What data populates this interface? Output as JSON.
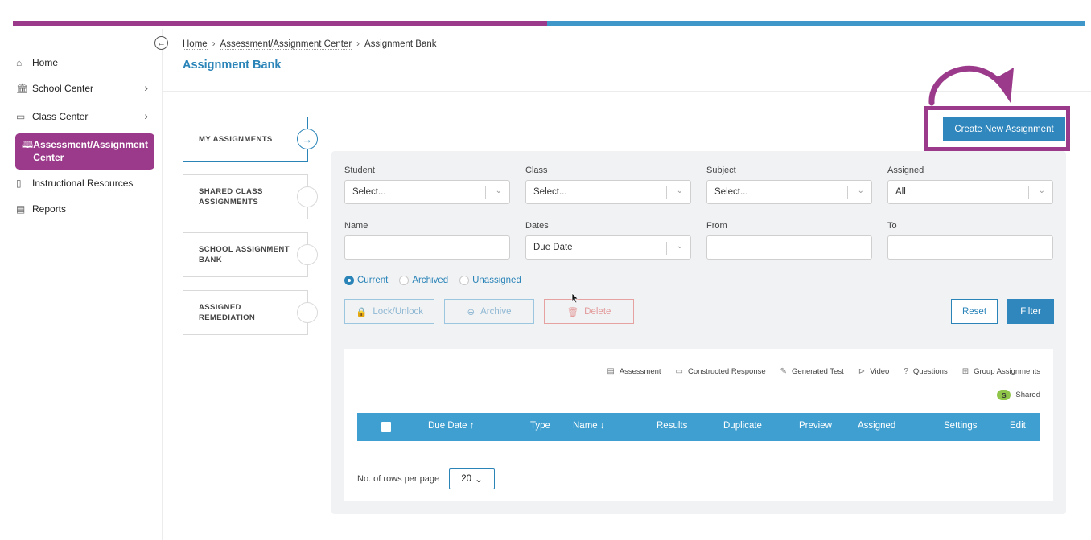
{
  "colors": {
    "brand_purple": "#9b3a8a",
    "brand_blue": "#3f97c9",
    "link_blue": "#2a84b8",
    "button_blue": "#2f87bd",
    "table_header": "#3f9fd0",
    "shared_badge": "#8fc64a"
  },
  "sidebar": {
    "items": [
      {
        "label": "Home",
        "icon": "home-icon"
      },
      {
        "label": "School Center",
        "icon": "school-icon"
      },
      {
        "label": "Class Center",
        "icon": "class-icon"
      },
      {
        "label": "Assessment/Assignment Center",
        "icon": "book-icon"
      },
      {
        "label": "Instructional Resources",
        "icon": "resources-icon"
      },
      {
        "label": "Reports",
        "icon": "reports-icon"
      }
    ]
  },
  "breadcrumb": {
    "home": "Home",
    "center": "Assessment/Assignment Center",
    "current": "Assignment Bank"
  },
  "page_title": "Assignment Bank",
  "tabs": [
    {
      "label": "MY ASSIGNMENTS"
    },
    {
      "label": "SHARED CLASS ASSIGNMENTS"
    },
    {
      "label": "SCHOOL ASSIGNMENT BANK"
    },
    {
      "label": "ASSIGNED REMEDIATION"
    }
  ],
  "create_button": "Create New Assignment",
  "filters": {
    "student": {
      "label": "Student",
      "value": "Select..."
    },
    "class": {
      "label": "Class",
      "value": "Select..."
    },
    "subject": {
      "label": "Subject",
      "value": "Select..."
    },
    "assigned": {
      "label": "Assigned",
      "value": "All"
    },
    "name": {
      "label": "Name",
      "value": ""
    },
    "dates": {
      "label": "Dates",
      "value": "Due Date"
    },
    "from": {
      "label": "From",
      "value": ""
    },
    "to": {
      "label": "To",
      "value": ""
    }
  },
  "status_radios": {
    "current": "Current",
    "archived": "Archived",
    "unassigned": "Unassigned",
    "selected": "Current"
  },
  "actions": {
    "lock": "Lock/Unlock",
    "archive": "Archive",
    "delete": "Delete",
    "reset": "Reset",
    "filter": "Filter"
  },
  "legend": {
    "assessment": "Assessment",
    "constructed": "Constructed Response",
    "generated": "Generated Test",
    "video": "Video",
    "questions": "Questions",
    "group": "Group Assignments",
    "shared_badge": "S",
    "shared": "Shared"
  },
  "table": {
    "columns": {
      "due_date": "Due Date",
      "type": "Type",
      "name": "Name",
      "results": "Results",
      "duplicate": "Duplicate",
      "preview": "Preview",
      "assigned": "Assigned",
      "settings": "Settings",
      "edit": "Edit"
    },
    "sort_icons": {
      "due_date": "↑",
      "name": "↓"
    }
  },
  "pagination": {
    "rows_label": "No. of rows per page",
    "rows_value": "20"
  }
}
